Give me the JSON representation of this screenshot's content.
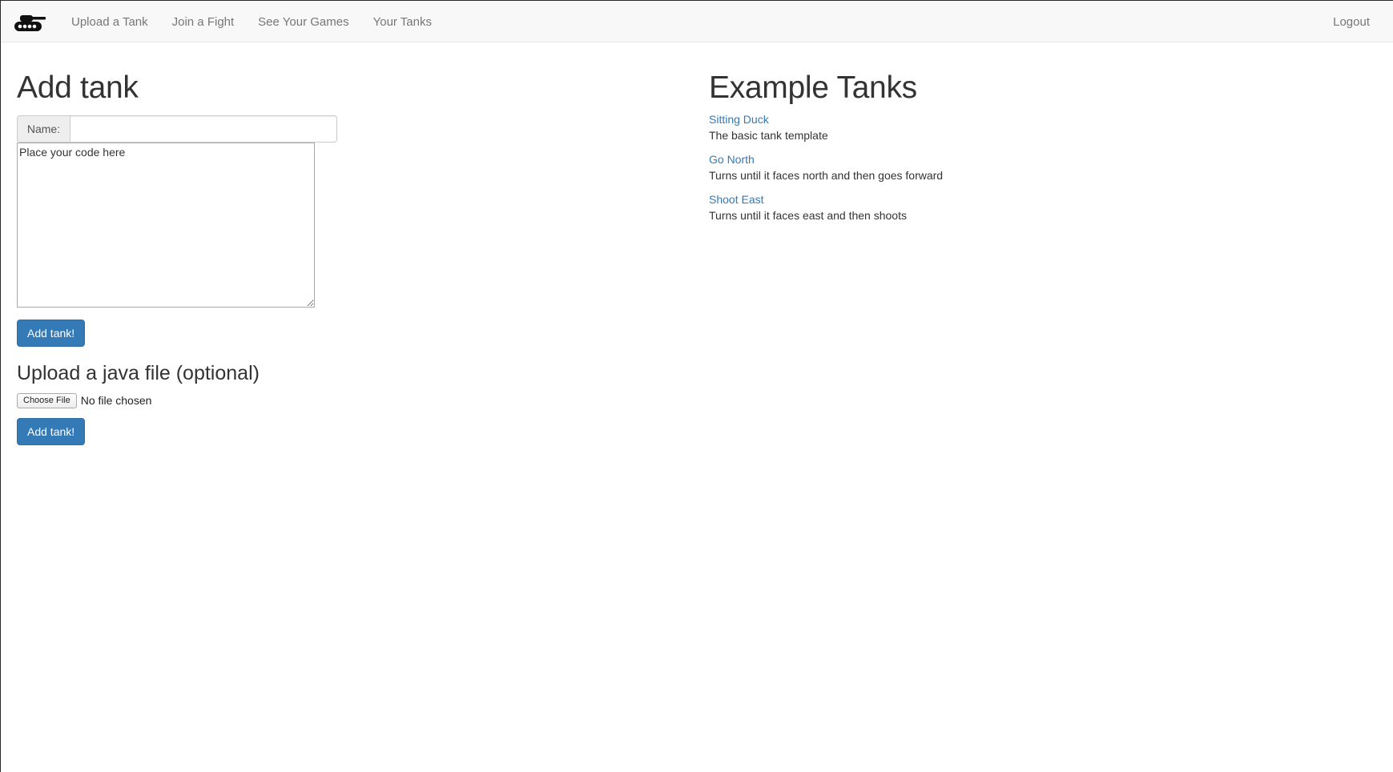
{
  "navbar": {
    "brand_icon": "tank-icon",
    "links": [
      "Upload a Tank",
      "Join a Fight",
      "See Your Games",
      "Your Tanks"
    ],
    "logout": "Logout"
  },
  "add_tank": {
    "title": "Add tank",
    "name_label": "Name:",
    "name_value": "",
    "code_placeholder": "Place your code here",
    "submit_label": "Add tank!"
  },
  "upload": {
    "title": "Upload a java file (optional)",
    "choose_label": "Choose File",
    "status": "No file chosen",
    "submit_label": "Add tank!"
  },
  "examples": {
    "title": "Example Tanks",
    "items": [
      {
        "name": "Sitting Duck",
        "description": "The basic tank template"
      },
      {
        "name": "Go North",
        "description": "Turns until it faces north and then goes forward"
      },
      {
        "name": "Shoot East",
        "description": "Turns until it faces east and then shoots"
      }
    ]
  },
  "colors": {
    "primary": "#337ab7",
    "navbar_bg": "#f8f8f8",
    "nav_text": "#777777"
  }
}
